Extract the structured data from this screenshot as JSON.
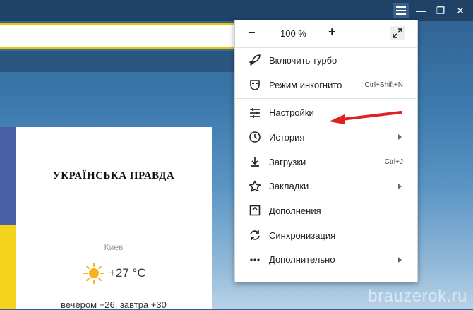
{
  "window": {
    "menu_icon": "hamburger-icon",
    "minimize": "—",
    "restore": "❐",
    "close": "✕"
  },
  "address": {
    "value": ""
  },
  "tile": {
    "brand": "УКРАЇНСЬКА ПРАВДА",
    "city": "Киев",
    "temperature": "+27 °C",
    "forecast": "вечером +26, завтра +30"
  },
  "menu": {
    "zoom": {
      "minus": "−",
      "value": "100 %",
      "plus": "+"
    },
    "items": [
      {
        "label": "Включить турбо",
        "icon": "rocket-icon",
        "shortcut": "",
        "submenu": false
      },
      {
        "label": "Режим инкогнито",
        "icon": "incognito-mask-icon",
        "shortcut": "Ctrl+Shift+N",
        "submenu": false
      },
      {
        "label": "Настройки",
        "icon": "settings-sliders-icon",
        "shortcut": "",
        "submenu": false
      },
      {
        "label": "История",
        "icon": "clock-icon",
        "shortcut": "",
        "submenu": true
      },
      {
        "label": "Загрузки",
        "icon": "download-icon",
        "shortcut": "Ctrl+J",
        "submenu": false
      },
      {
        "label": "Закладки",
        "icon": "star-icon",
        "shortcut": "",
        "submenu": true
      },
      {
        "label": "Дополнения",
        "icon": "extensions-icon",
        "shortcut": "",
        "submenu": false
      },
      {
        "label": "Синхронизация",
        "icon": "sync-icon",
        "shortcut": "",
        "submenu": false
      },
      {
        "label": "Дополнительно",
        "icon": "more-dots-icon",
        "shortcut": "",
        "submenu": true
      }
    ]
  },
  "annotation_color": "#e02020",
  "accent_color": "#f2c200",
  "watermark": "brauzerok.ru"
}
